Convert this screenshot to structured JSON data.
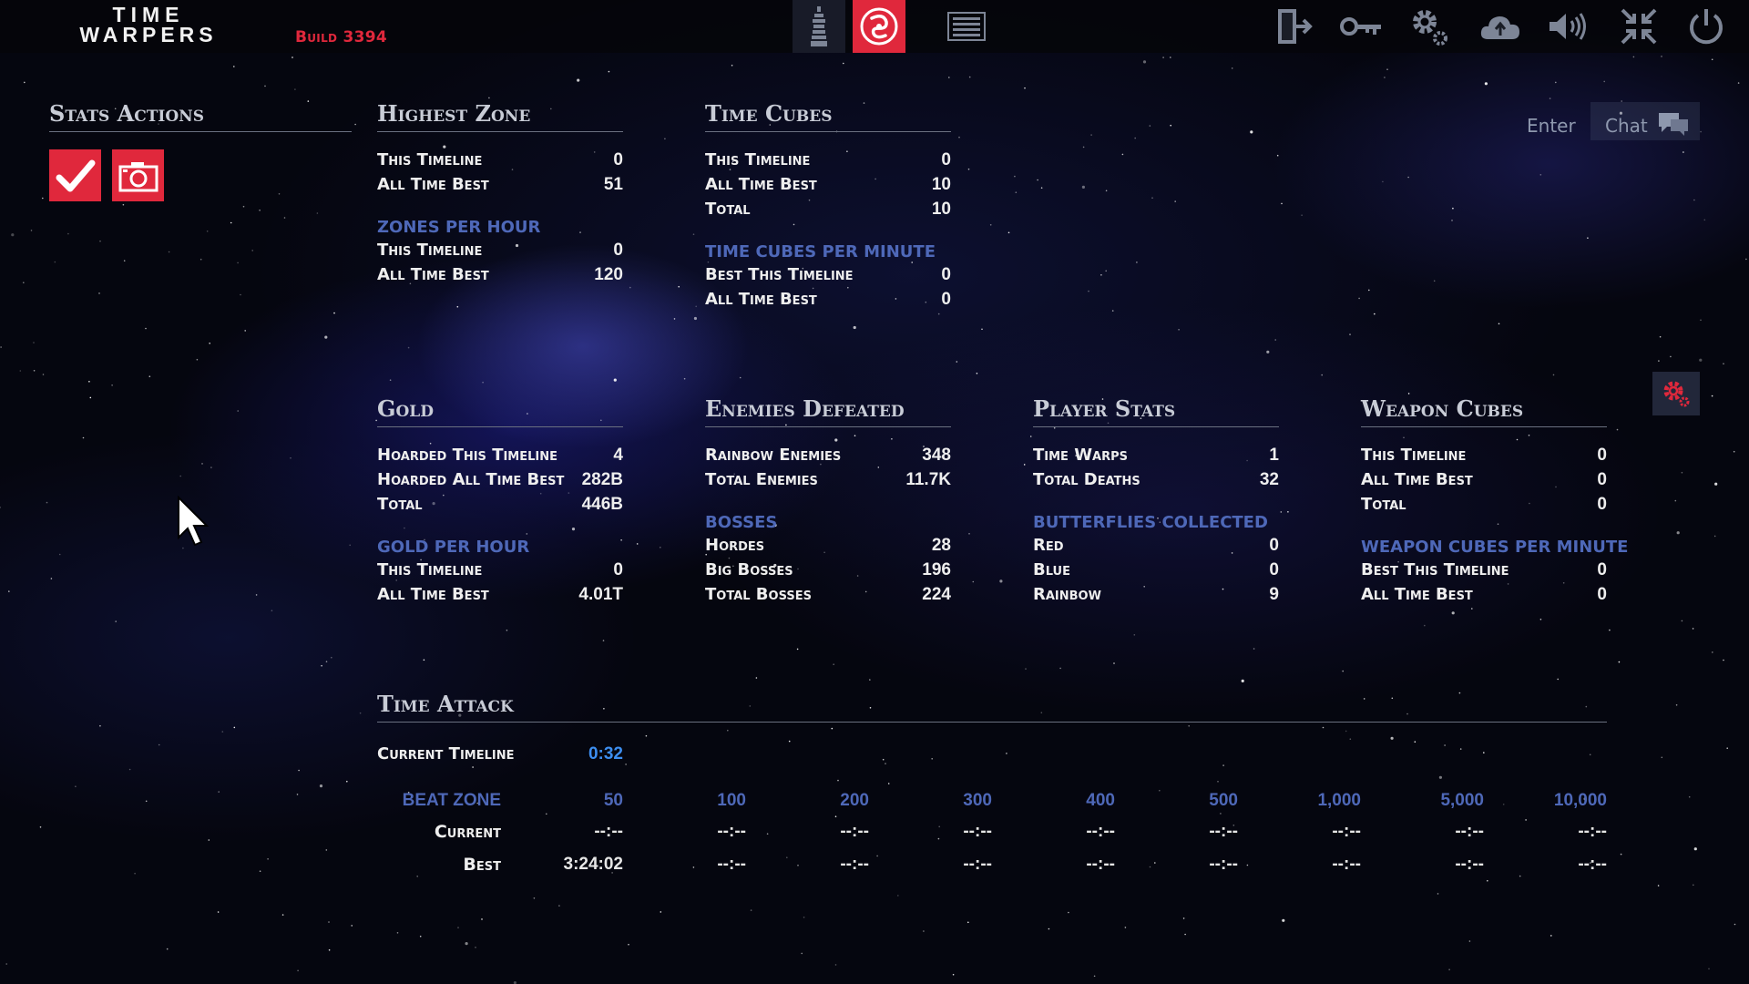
{
  "header": {
    "logo_line1": "TIME",
    "logo_line2": "WARPERS",
    "build": "Build 3394",
    "icons": [
      "tower-icon",
      "chaos-logo-icon",
      "list-icon",
      "exit-door-icon",
      "key-icon",
      "settings-gears-icon",
      "cloud-upload-icon",
      "volume-icon",
      "collapse-icon",
      "power-icon"
    ]
  },
  "chat": {
    "enter_label": "Enter",
    "chat_label": "Chat"
  },
  "stats_actions": {
    "title": "Stats Actions"
  },
  "highest_zone": {
    "title": "Highest Zone",
    "rows": [
      {
        "label": "This Timeline",
        "value": "0"
      },
      {
        "label": "All Time Best",
        "value": "51"
      }
    ],
    "sub_title": "ZONES PER HOUR",
    "sub_rows": [
      {
        "label": "This Timeline",
        "value": "0"
      },
      {
        "label": "All Time Best",
        "value": "120"
      }
    ]
  },
  "time_cubes": {
    "title": "Time Cubes",
    "rows": [
      {
        "label": "This Timeline",
        "value": "0"
      },
      {
        "label": "All Time Best",
        "value": "10"
      },
      {
        "label": "Total",
        "value": "10"
      }
    ],
    "sub_title": "TIME CUBES PER MINUTE",
    "sub_rows": [
      {
        "label": "Best This Timeline",
        "value": "0"
      },
      {
        "label": "All Time Best",
        "value": "0"
      }
    ]
  },
  "gold": {
    "title": "Gold",
    "rows": [
      {
        "label": "Hoarded This Timeline",
        "value": "4"
      },
      {
        "label": "Hoarded All Time Best",
        "value": "282B"
      },
      {
        "label": "Total",
        "value": "446B"
      }
    ],
    "sub_title": "GOLD PER HOUR",
    "sub_rows": [
      {
        "label": "This Timeline",
        "value": "0"
      },
      {
        "label": "All Time Best",
        "value": "4.01T"
      }
    ]
  },
  "enemies_defeated": {
    "title": "Enemies Defeated",
    "rows": [
      {
        "label": "Rainbow Enemies",
        "value": "348"
      },
      {
        "label": "Total Enemies",
        "value": "11.7K"
      }
    ],
    "sub_title": "BOSSES",
    "sub_rows": [
      {
        "label": "Hordes",
        "value": "28"
      },
      {
        "label": "Big Bosses",
        "value": "196"
      },
      {
        "label": "Total Bosses",
        "value": "224"
      }
    ]
  },
  "player_stats": {
    "title": "Player Stats",
    "rows": [
      {
        "label": "Time Warps",
        "value": "1"
      },
      {
        "label": "Total Deaths",
        "value": "32"
      }
    ],
    "sub_title": "BUTTERFLIES COLLECTED",
    "sub_rows": [
      {
        "label": "Red",
        "value": "0"
      },
      {
        "label": "Blue",
        "value": "0"
      },
      {
        "label": "Rainbow",
        "value": "9"
      }
    ]
  },
  "weapon_cubes": {
    "title": "Weapon Cubes",
    "rows": [
      {
        "label": "This Timeline",
        "value": "0"
      },
      {
        "label": "All Time Best",
        "value": "0"
      },
      {
        "label": "Total",
        "value": "0"
      }
    ],
    "sub_title": "WEAPON CUBES PER MINUTE",
    "sub_rows": [
      {
        "label": "Best This Timeline",
        "value": "0"
      },
      {
        "label": "All Time Best",
        "value": "0"
      }
    ]
  },
  "time_attack": {
    "title": "Time Attack",
    "current_timeline_label": "Current Timeline",
    "current_timeline_value": "0:32",
    "beat_zone_label": "BEAT ZONE",
    "current_label": "Current",
    "best_label": "Best",
    "zones": [
      "50",
      "100",
      "200",
      "300",
      "400",
      "500",
      "1,000",
      "5,000",
      "10,000"
    ],
    "current": [
      "--:--",
      "--:--",
      "--:--",
      "--:--",
      "--:--",
      "--:--",
      "--:--",
      "--:--",
      "--:--"
    ],
    "best": [
      "3:24:02",
      "--:--",
      "--:--",
      "--:--",
      "--:--",
      "--:--",
      "--:--",
      "--:--",
      "--:--"
    ]
  },
  "colors": {
    "accent_red": "#e0283c",
    "subhead_blue": "#4e68b8",
    "timer_blue": "#3d8ef0"
  }
}
